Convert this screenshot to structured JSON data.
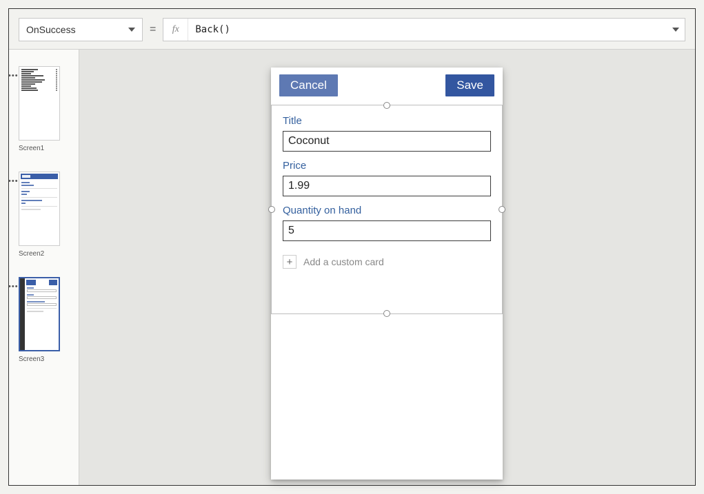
{
  "formulaBar": {
    "property": "OnSuccess",
    "equals": "=",
    "fx": "fx",
    "formula": "Back()"
  },
  "thumbs": {
    "screen1": "Screen1",
    "screen2": "Screen2",
    "screen3": "Screen3",
    "dots": "•••"
  },
  "phone": {
    "cancel": "Cancel",
    "save": "Save",
    "fields": {
      "title": {
        "label": "Title",
        "value": "Coconut"
      },
      "price": {
        "label": "Price",
        "value": "1.99"
      },
      "qty": {
        "label": "Quantity on hand",
        "value": "5"
      }
    },
    "addCard": {
      "plus": "+",
      "label": "Add a custom card"
    }
  }
}
